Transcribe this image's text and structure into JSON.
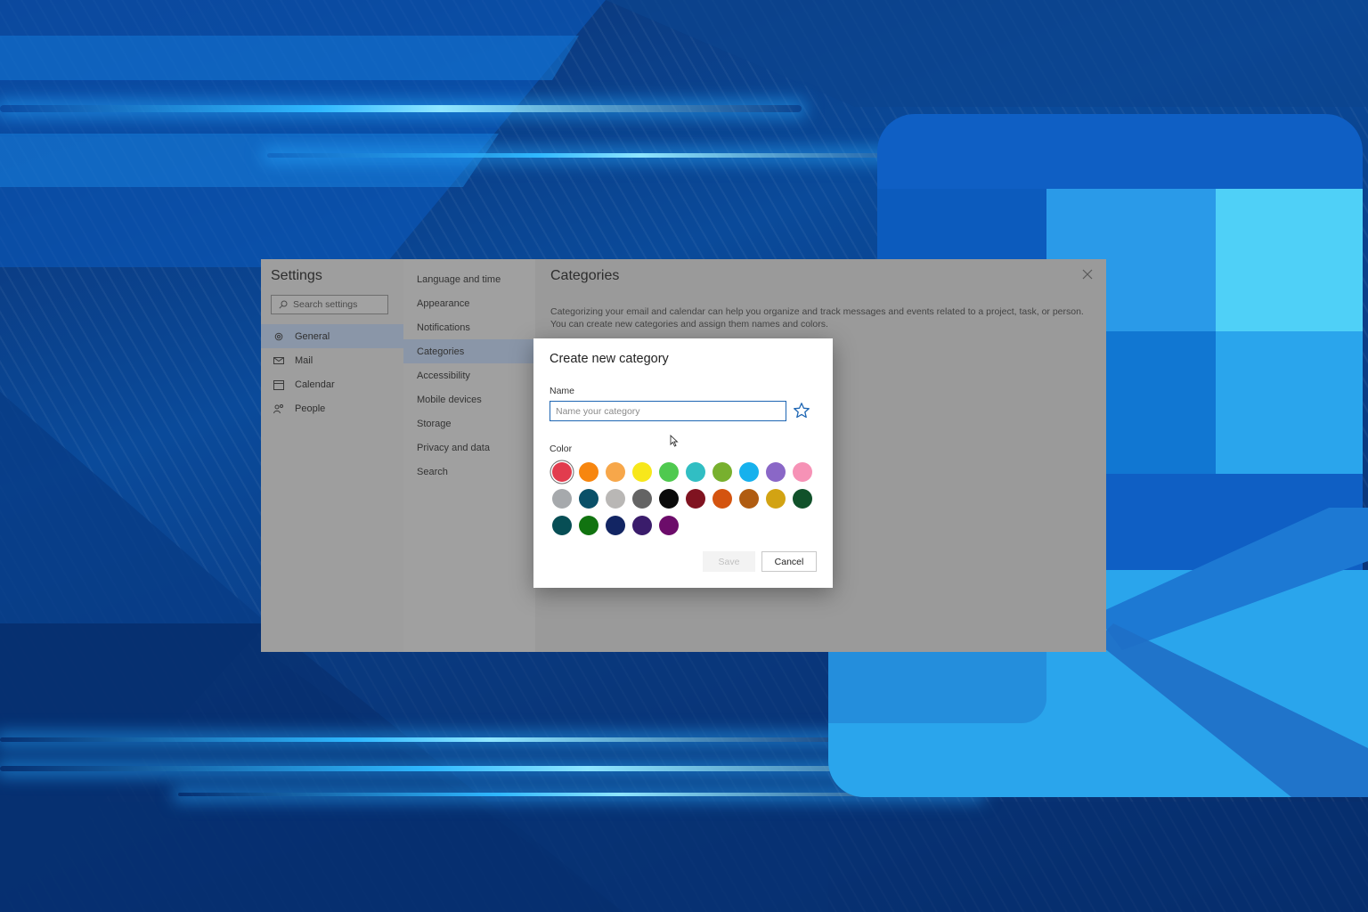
{
  "settings": {
    "title": "Settings",
    "search_placeholder": "Search settings",
    "nav": [
      {
        "label": "General",
        "icon": "gear-icon",
        "active": true
      },
      {
        "label": "Mail",
        "icon": "mail-icon",
        "active": false
      },
      {
        "label": "Calendar",
        "icon": "calendar-icon",
        "active": false
      },
      {
        "label": "People",
        "icon": "people-icon",
        "active": false
      }
    ],
    "subnav": [
      {
        "label": "Language and time",
        "active": false
      },
      {
        "label": "Appearance",
        "active": false
      },
      {
        "label": "Notifications",
        "active": false
      },
      {
        "label": "Categories",
        "active": true
      },
      {
        "label": "Accessibility",
        "active": false
      },
      {
        "label": "Mobile devices",
        "active": false
      },
      {
        "label": "Storage",
        "active": false
      },
      {
        "label": "Privacy and data",
        "active": false
      },
      {
        "label": "Search",
        "active": false
      }
    ],
    "content_title": "Categories",
    "content_description": "Categorizing your email and calendar can help you organize and track messages and events related to a project, task, or person. You can create new categories and assign them names and colors."
  },
  "dialog": {
    "title": "Create new category",
    "name_label": "Name",
    "name_placeholder": "Name your category",
    "name_value": "",
    "color_label": "Color",
    "colors": [
      "#e23c4e",
      "#f7860f",
      "#f7a74a",
      "#f7e71b",
      "#4fc94f",
      "#31bec3",
      "#78b02e",
      "#17b1ed",
      "#8a67c7",
      "#f692b6",
      "#a6a9ac",
      "#0a5068",
      "#b9b7b5",
      "#646464",
      "#0a0a0a",
      "#801320",
      "#d4540f",
      "#b05c11",
      "#d2a313",
      "#11512a",
      "#074e55",
      "#117310",
      "#122563",
      "#3a1c6b",
      "#6c0c6a"
    ],
    "selected_color_index": 0,
    "save_label": "Save",
    "cancel_label": "Cancel"
  }
}
